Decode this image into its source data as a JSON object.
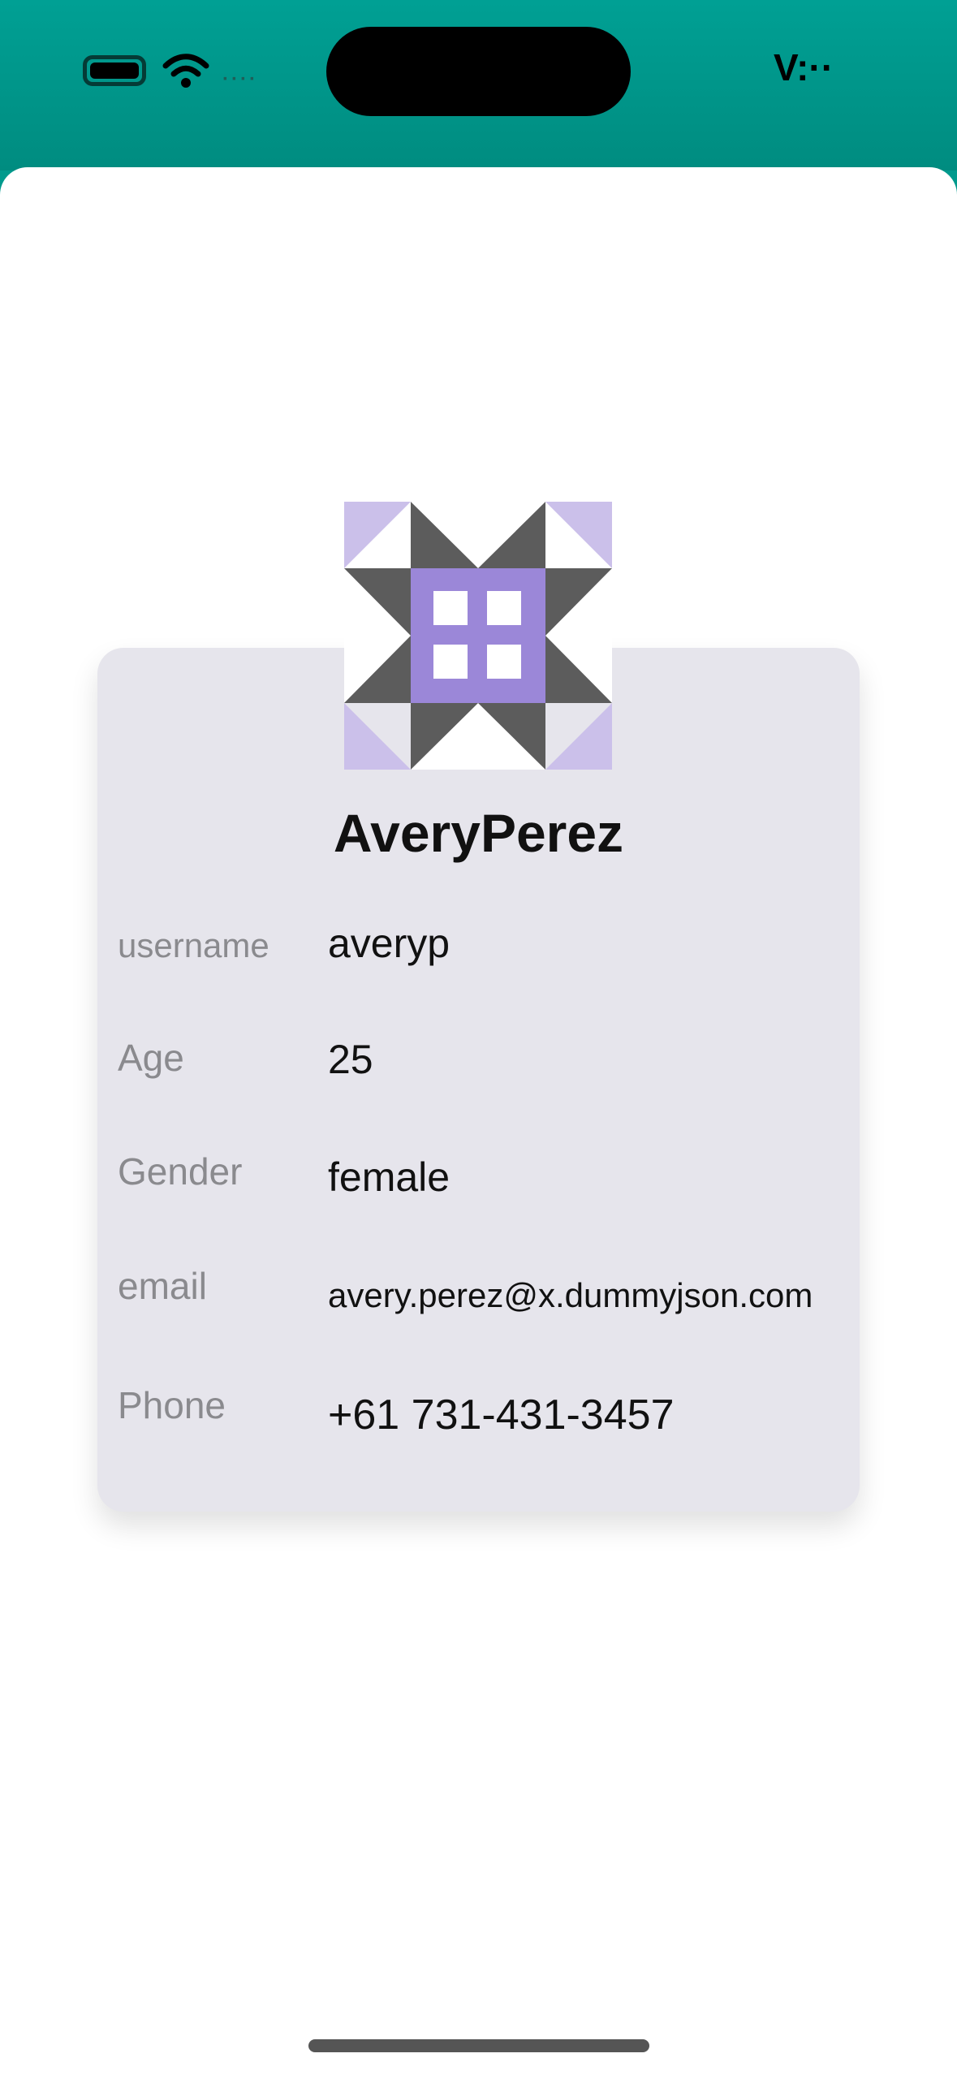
{
  "status_bar": {
    "time": "V:··",
    "signal_dots": "····",
    "icons": [
      "battery-icon",
      "wifi-icon",
      "cellular-icon"
    ]
  },
  "profile": {
    "full_name": "AveryPerez",
    "avatar_icon": "identicon-avatar",
    "fields": {
      "username": {
        "label": "username",
        "value": "averyp"
      },
      "age": {
        "label": "Age",
        "value": "25"
      },
      "gender": {
        "label": "Gender",
        "value": "female"
      },
      "email": {
        "label": "email",
        "value": "avery.perez@x.dummyjson.com"
      },
      "phone": {
        "label": "Phone",
        "value": "+61 731-431-3457"
      }
    }
  },
  "colors": {
    "header": "#009a8d",
    "card": "#e6e5ec",
    "avatar_purple": "#9b87d8",
    "avatar_light_purple": "#cbc0ea",
    "avatar_gray": "#5c5c5c"
  }
}
